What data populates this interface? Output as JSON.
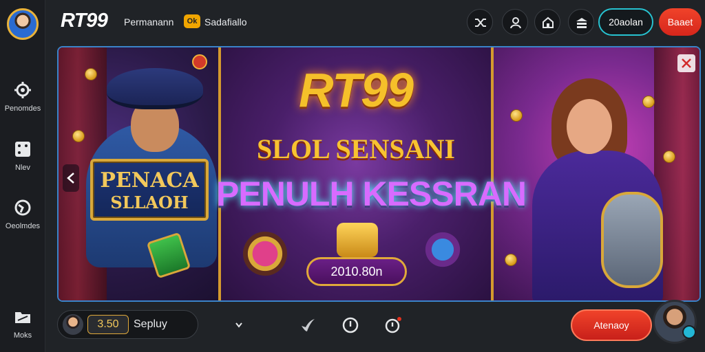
{
  "sidebar": {
    "items": [
      {
        "label": "Penomdes",
        "icon": "gear-icon"
      },
      {
        "label": "Nlev",
        "icon": "dice-icon"
      },
      {
        "label": "Oeolmdes",
        "icon": "globe-icon"
      },
      {
        "label": "Moks",
        "icon": "folder-icon"
      }
    ]
  },
  "header": {
    "logo": "RT99",
    "nav_text_1": "Permanann",
    "nav_badge": "Ok",
    "nav_text_2": "Sadafiallo",
    "icons": [
      "shuffle-icon",
      "user-icon",
      "home-icon",
      "cash-icon"
    ],
    "outline_button": "20aolan",
    "red_button": "Baaet"
  },
  "banner": {
    "left_sign_line1": "PENACA",
    "left_sign_line2": "SLLAOH",
    "title_main": "RT99",
    "title_sub": "SLOL SENSANI",
    "title_big": "PENULH KESSRAN",
    "amount": "2010.80n"
  },
  "bottom": {
    "balance_amount": "3.50",
    "balance_label": "Sepluy",
    "icons": [
      "check-icon",
      "info-icon",
      "notification-icon"
    ],
    "action_button": "Atenaoy"
  },
  "colors": {
    "accent_cyan": "#27c3d1",
    "accent_red": "#e2321f",
    "gold": "#f2c85b"
  }
}
